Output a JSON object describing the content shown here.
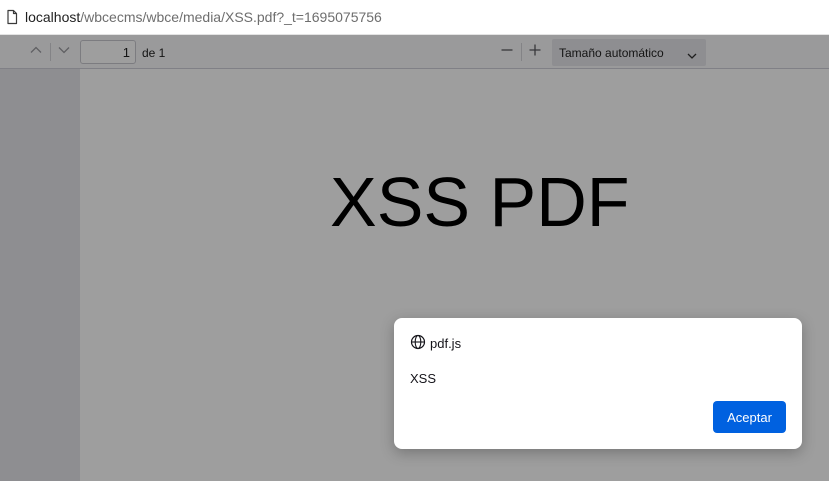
{
  "addressbar": {
    "host": "localhost",
    "path": "/wbcecms/wbce/media/XSS.pdf?_t=1695075756"
  },
  "toolbar": {
    "page_number": "1",
    "page_count_label": "de 1",
    "zoom_label": "Tamaño automático"
  },
  "document": {
    "heading": "XSS PDF"
  },
  "dialog": {
    "origin": "pdf.js",
    "message": "XSS",
    "accept_label": "Aceptar",
    "accent_color": "#0061e0"
  },
  "icons": {
    "page": "page-icon",
    "previous": "chevron-up-icon",
    "next": "chevron-down-icon",
    "zoom_out": "minus-icon",
    "zoom_in": "plus-icon",
    "zoom_dropdown": "chevron-down-icon",
    "origin": "globe-icon"
  }
}
